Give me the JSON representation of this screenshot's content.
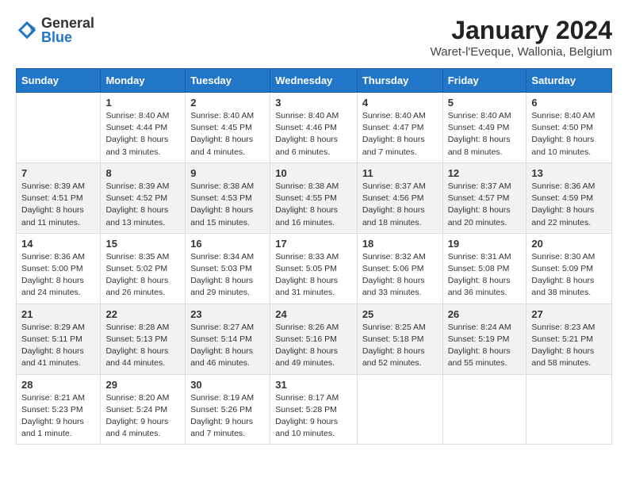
{
  "header": {
    "logo_general": "General",
    "logo_blue": "Blue",
    "title": "January 2024",
    "location": "Waret-l'Eveque, Wallonia, Belgium"
  },
  "weekdays": [
    "Sunday",
    "Monday",
    "Tuesday",
    "Wednesday",
    "Thursday",
    "Friday",
    "Saturday"
  ],
  "weeks": [
    [
      {
        "day": "",
        "sunrise": "",
        "sunset": "",
        "daylight": ""
      },
      {
        "day": "1",
        "sunrise": "Sunrise: 8:40 AM",
        "sunset": "Sunset: 4:44 PM",
        "daylight": "Daylight: 8 hours and 3 minutes."
      },
      {
        "day": "2",
        "sunrise": "Sunrise: 8:40 AM",
        "sunset": "Sunset: 4:45 PM",
        "daylight": "Daylight: 8 hours and 4 minutes."
      },
      {
        "day": "3",
        "sunrise": "Sunrise: 8:40 AM",
        "sunset": "Sunset: 4:46 PM",
        "daylight": "Daylight: 8 hours and 6 minutes."
      },
      {
        "day": "4",
        "sunrise": "Sunrise: 8:40 AM",
        "sunset": "Sunset: 4:47 PM",
        "daylight": "Daylight: 8 hours and 7 minutes."
      },
      {
        "day": "5",
        "sunrise": "Sunrise: 8:40 AM",
        "sunset": "Sunset: 4:49 PM",
        "daylight": "Daylight: 8 hours and 8 minutes."
      },
      {
        "day": "6",
        "sunrise": "Sunrise: 8:40 AM",
        "sunset": "Sunset: 4:50 PM",
        "daylight": "Daylight: 8 hours and 10 minutes."
      }
    ],
    [
      {
        "day": "7",
        "sunrise": "Sunrise: 8:39 AM",
        "sunset": "Sunset: 4:51 PM",
        "daylight": "Daylight: 8 hours and 11 minutes."
      },
      {
        "day": "8",
        "sunrise": "Sunrise: 8:39 AM",
        "sunset": "Sunset: 4:52 PM",
        "daylight": "Daylight: 8 hours and 13 minutes."
      },
      {
        "day": "9",
        "sunrise": "Sunrise: 8:38 AM",
        "sunset": "Sunset: 4:53 PM",
        "daylight": "Daylight: 8 hours and 15 minutes."
      },
      {
        "day": "10",
        "sunrise": "Sunrise: 8:38 AM",
        "sunset": "Sunset: 4:55 PM",
        "daylight": "Daylight: 8 hours and 16 minutes."
      },
      {
        "day": "11",
        "sunrise": "Sunrise: 8:37 AM",
        "sunset": "Sunset: 4:56 PM",
        "daylight": "Daylight: 8 hours and 18 minutes."
      },
      {
        "day": "12",
        "sunrise": "Sunrise: 8:37 AM",
        "sunset": "Sunset: 4:57 PM",
        "daylight": "Daylight: 8 hours and 20 minutes."
      },
      {
        "day": "13",
        "sunrise": "Sunrise: 8:36 AM",
        "sunset": "Sunset: 4:59 PM",
        "daylight": "Daylight: 8 hours and 22 minutes."
      }
    ],
    [
      {
        "day": "14",
        "sunrise": "Sunrise: 8:36 AM",
        "sunset": "Sunset: 5:00 PM",
        "daylight": "Daylight: 8 hours and 24 minutes."
      },
      {
        "day": "15",
        "sunrise": "Sunrise: 8:35 AM",
        "sunset": "Sunset: 5:02 PM",
        "daylight": "Daylight: 8 hours and 26 minutes."
      },
      {
        "day": "16",
        "sunrise": "Sunrise: 8:34 AM",
        "sunset": "Sunset: 5:03 PM",
        "daylight": "Daylight: 8 hours and 29 minutes."
      },
      {
        "day": "17",
        "sunrise": "Sunrise: 8:33 AM",
        "sunset": "Sunset: 5:05 PM",
        "daylight": "Daylight: 8 hours and 31 minutes."
      },
      {
        "day": "18",
        "sunrise": "Sunrise: 8:32 AM",
        "sunset": "Sunset: 5:06 PM",
        "daylight": "Daylight: 8 hours and 33 minutes."
      },
      {
        "day": "19",
        "sunrise": "Sunrise: 8:31 AM",
        "sunset": "Sunset: 5:08 PM",
        "daylight": "Daylight: 8 hours and 36 minutes."
      },
      {
        "day": "20",
        "sunrise": "Sunrise: 8:30 AM",
        "sunset": "Sunset: 5:09 PM",
        "daylight": "Daylight: 8 hours and 38 minutes."
      }
    ],
    [
      {
        "day": "21",
        "sunrise": "Sunrise: 8:29 AM",
        "sunset": "Sunset: 5:11 PM",
        "daylight": "Daylight: 8 hours and 41 minutes."
      },
      {
        "day": "22",
        "sunrise": "Sunrise: 8:28 AM",
        "sunset": "Sunset: 5:13 PM",
        "daylight": "Daylight: 8 hours and 44 minutes."
      },
      {
        "day": "23",
        "sunrise": "Sunrise: 8:27 AM",
        "sunset": "Sunset: 5:14 PM",
        "daylight": "Daylight: 8 hours and 46 minutes."
      },
      {
        "day": "24",
        "sunrise": "Sunrise: 8:26 AM",
        "sunset": "Sunset: 5:16 PM",
        "daylight": "Daylight: 8 hours and 49 minutes."
      },
      {
        "day": "25",
        "sunrise": "Sunrise: 8:25 AM",
        "sunset": "Sunset: 5:18 PM",
        "daylight": "Daylight: 8 hours and 52 minutes."
      },
      {
        "day": "26",
        "sunrise": "Sunrise: 8:24 AM",
        "sunset": "Sunset: 5:19 PM",
        "daylight": "Daylight: 8 hours and 55 minutes."
      },
      {
        "day": "27",
        "sunrise": "Sunrise: 8:23 AM",
        "sunset": "Sunset: 5:21 PM",
        "daylight": "Daylight: 8 hours and 58 minutes."
      }
    ],
    [
      {
        "day": "28",
        "sunrise": "Sunrise: 8:21 AM",
        "sunset": "Sunset: 5:23 PM",
        "daylight": "Daylight: 9 hours and 1 minute."
      },
      {
        "day": "29",
        "sunrise": "Sunrise: 8:20 AM",
        "sunset": "Sunset: 5:24 PM",
        "daylight": "Daylight: 9 hours and 4 minutes."
      },
      {
        "day": "30",
        "sunrise": "Sunrise: 8:19 AM",
        "sunset": "Sunset: 5:26 PM",
        "daylight": "Daylight: 9 hours and 7 minutes."
      },
      {
        "day": "31",
        "sunrise": "Sunrise: 8:17 AM",
        "sunset": "Sunset: 5:28 PM",
        "daylight": "Daylight: 9 hours and 10 minutes."
      },
      {
        "day": "",
        "sunrise": "",
        "sunset": "",
        "daylight": ""
      },
      {
        "day": "",
        "sunrise": "",
        "sunset": "",
        "daylight": ""
      },
      {
        "day": "",
        "sunrise": "",
        "sunset": "",
        "daylight": ""
      }
    ]
  ]
}
